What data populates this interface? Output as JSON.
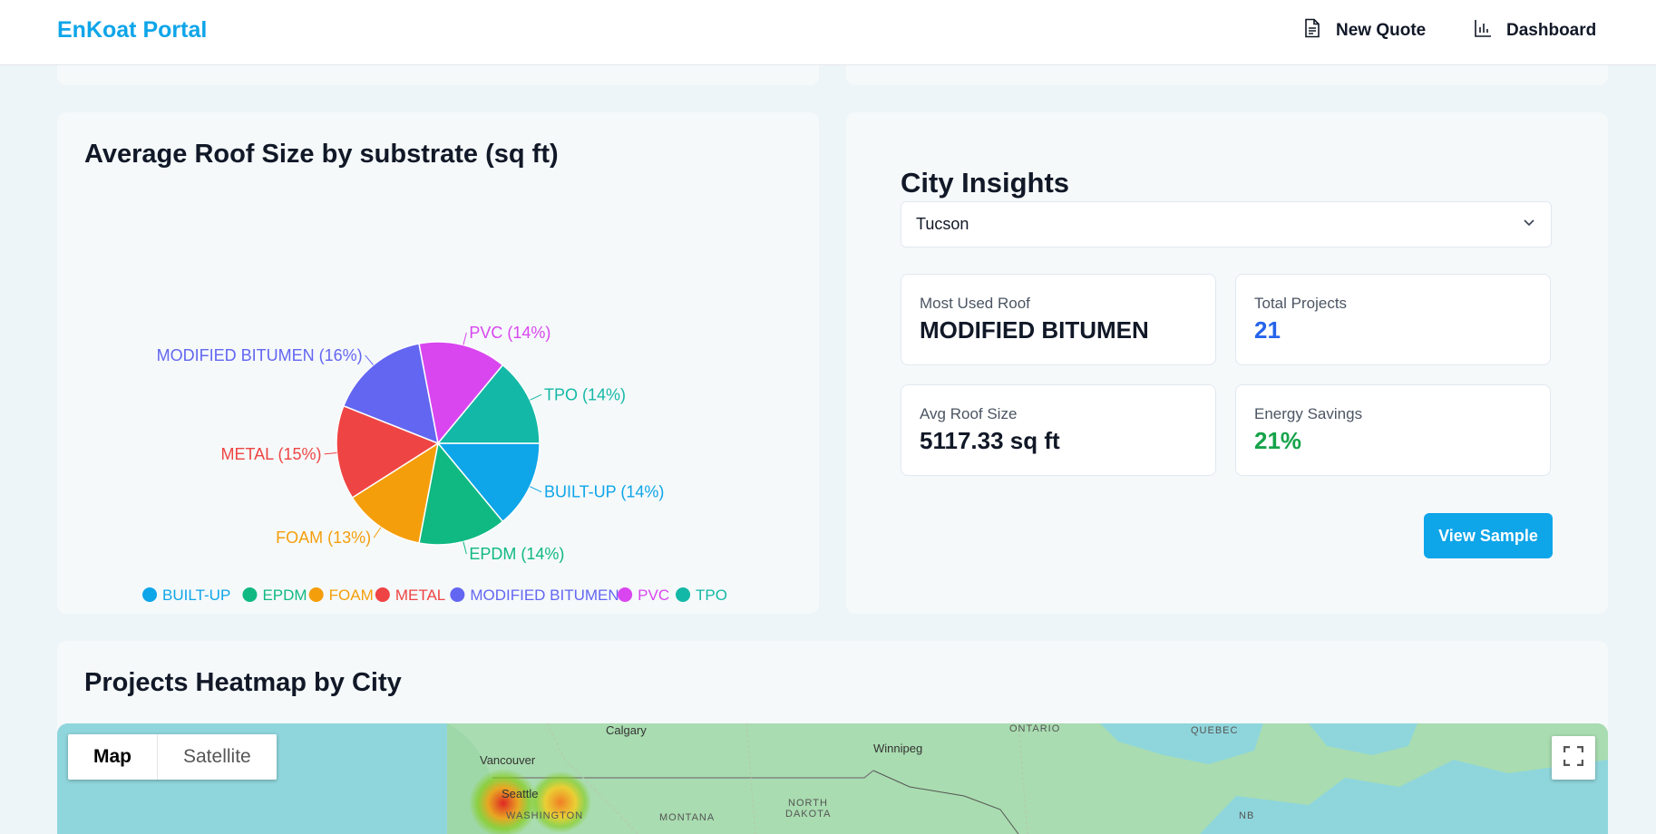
{
  "header": {
    "brand": "EnKoat Portal",
    "nav": [
      {
        "label": "New Quote",
        "icon": "document-icon"
      },
      {
        "label": "Dashboard",
        "icon": "bar-chart-icon"
      }
    ]
  },
  "roof_chart": {
    "title": "Average Roof Size by substrate (sq ft)"
  },
  "chart_data": {
    "type": "pie",
    "title": "Average Roof Size by substrate (sq ft)",
    "slices": [
      {
        "label": "BUILT-UP",
        "percent": 14,
        "color": "#0ea5e9"
      },
      {
        "label": "EPDM",
        "percent": 14,
        "color": "#10b981"
      },
      {
        "label": "FOAM",
        "percent": 13,
        "color": "#f59e0b"
      },
      {
        "label": "METAL",
        "percent": 15,
        "color": "#ef4444"
      },
      {
        "label": "MODIFIED BITUMEN",
        "percent": 16,
        "color": "#6366f1"
      },
      {
        "label": "PVC",
        "percent": 14,
        "color": "#d946ef"
      },
      {
        "label": "TPO",
        "percent": 14,
        "color": "#14b8a6"
      }
    ],
    "slice_labels": [
      "BUILT-UP (14%)",
      "EPDM (14%)",
      "FOAM (13%)",
      "METAL (15%)",
      "MODIFIED BITUMEN (16%)",
      "PVC (14%)",
      "TPO (14%)"
    ],
    "legend_placement": "bottom"
  },
  "city": {
    "title": "City Insights",
    "selected_city": "Tucson",
    "stats": {
      "most_used_label": "Most Used Roof",
      "most_used_value": "MODIFIED BITUMEN",
      "total_projects_label": "Total Projects",
      "total_projects_value": "21",
      "avg_size_label": "Avg Roof Size",
      "avg_size_value": "5117.33 sq ft",
      "energy_label": "Energy Savings",
      "energy_value": "21%"
    },
    "colors": {
      "total_projects": "#2563eb",
      "energy": "#16a34a"
    },
    "view_sample_label": "View Sample"
  },
  "heatmap": {
    "title": "Projects Heatmap by City",
    "map_type_options": [
      "Map",
      "Satellite"
    ],
    "selected_map_type": "Map",
    "labels": {
      "calgary": "Calgary",
      "ontario": "ONTARIO",
      "quebec": "QUEBEC",
      "vancouver": "Vancouver",
      "winnipeg": "Winnipeg",
      "seattle": "Seattle",
      "washington": "WASHINGTON",
      "montana": "MONTANA",
      "north_dakota_1": "NORTH",
      "north_dakota_2": "DAKOTA",
      "nb": "NB"
    }
  }
}
